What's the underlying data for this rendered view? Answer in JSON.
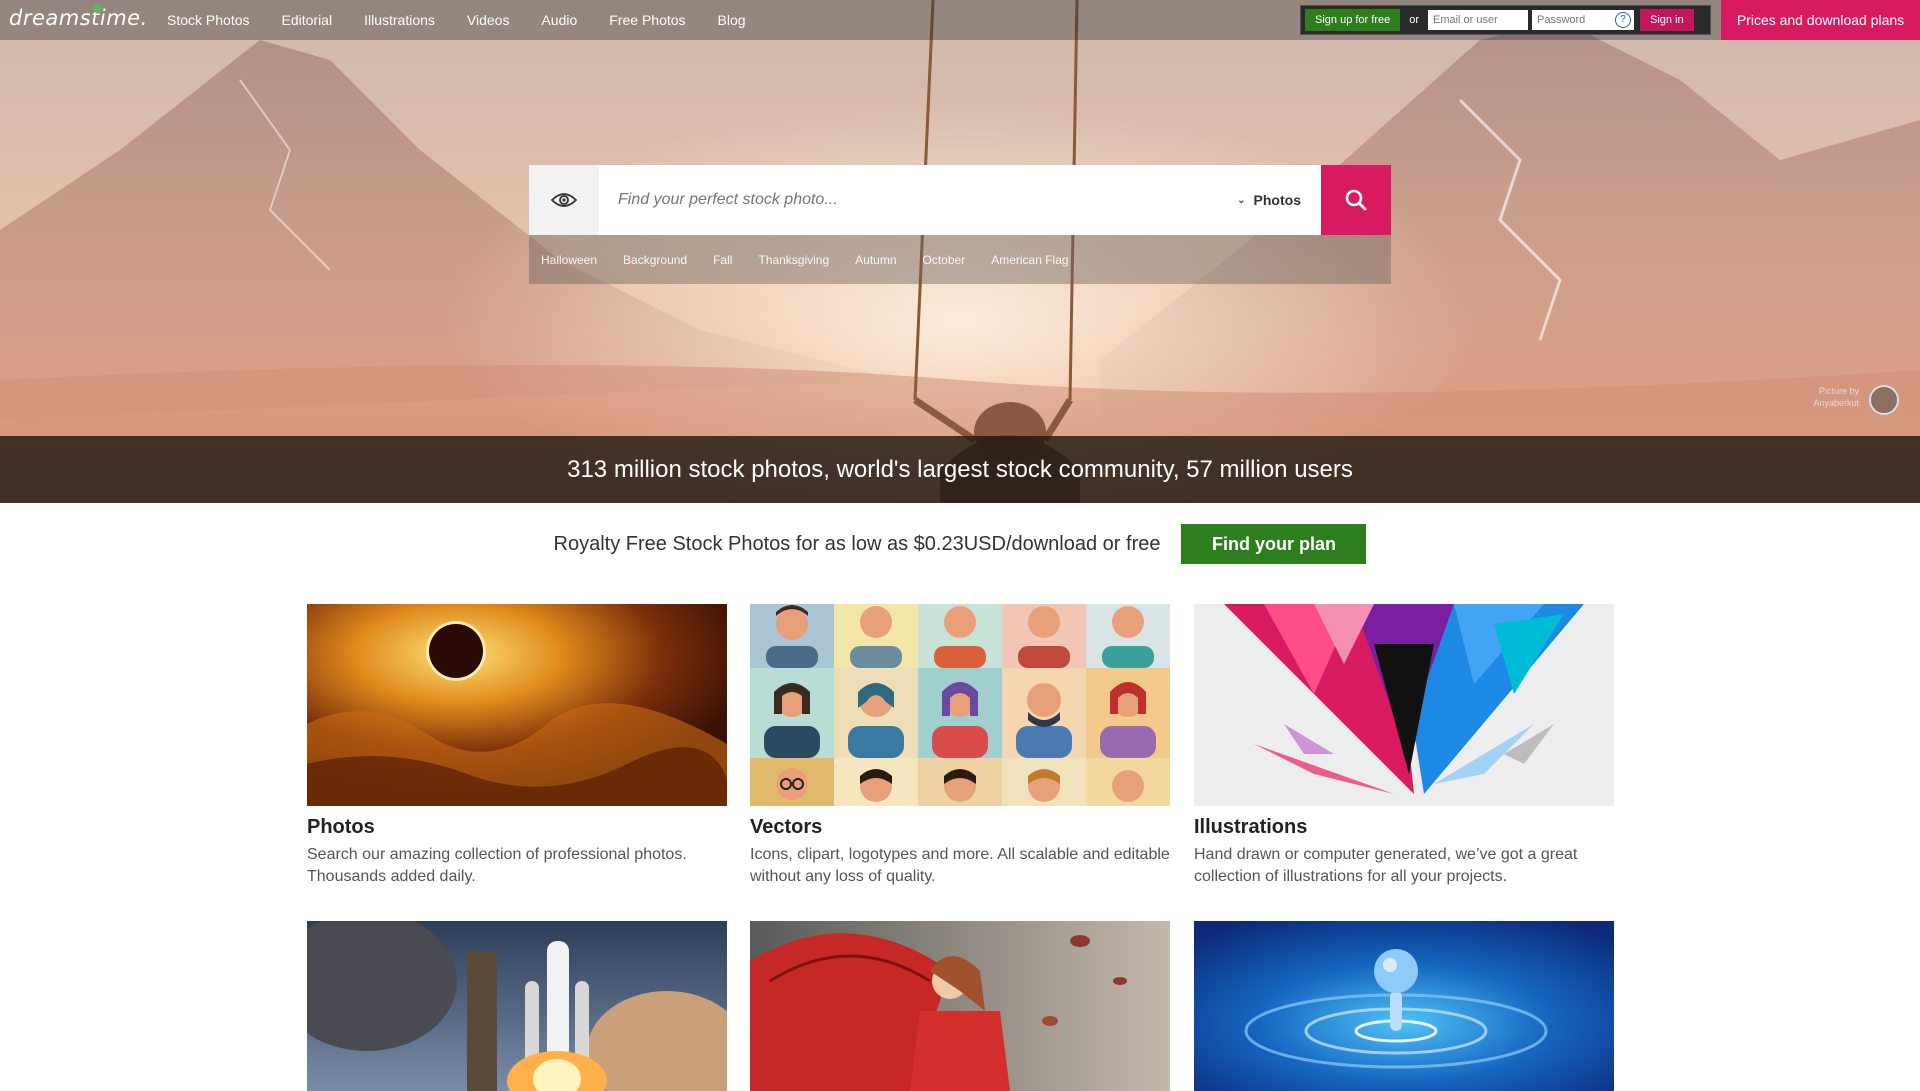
{
  "brand": {
    "logo_text": "dreamstime."
  },
  "nav": {
    "links": [
      "Stock Photos",
      "Editorial",
      "Illustrations",
      "Videos",
      "Audio",
      "Free Photos",
      "Blog"
    ]
  },
  "login": {
    "signup_label": "Sign up for free",
    "or_label": "or",
    "email_placeholder": "Email or user",
    "password_placeholder": "Password",
    "help_icon": "?",
    "signin_label": "Sign in",
    "prices_label": "Prices and download plans"
  },
  "search": {
    "placeholder": "Find your perfect stock photo...",
    "type_label": "Photos",
    "eye_icon": "eye-icon",
    "search_icon": "search-icon",
    "suggestions": [
      "Halloween",
      "Background",
      "Fall",
      "Thanksgiving",
      "Autumn",
      "October",
      "American Flag"
    ]
  },
  "hero": {
    "credit_text": "Picture by Anyaberkut",
    "stats_text": "313 million stock photos, world's largest stock community, 57 million users"
  },
  "promo": {
    "text": "Royalty Free Stock Photos for as low as $0.23USD/download or free",
    "button_label": "Find your plan"
  },
  "cards": [
    {
      "title": "Photos",
      "desc": "Search our amazing collection of professional photos. Thousands added daily."
    },
    {
      "title": "Vectors",
      "desc": "Icons, clipart, logotypes and more. All scalable and editable without any loss of quality."
    },
    {
      "title": "Illustrations",
      "desc": "Hand drawn or computer generated, we’ve got a great collection of illustrations for all your projects."
    }
  ],
  "colors": {
    "accent_pink": "#d81b60",
    "accent_green": "#2e7d1e"
  }
}
